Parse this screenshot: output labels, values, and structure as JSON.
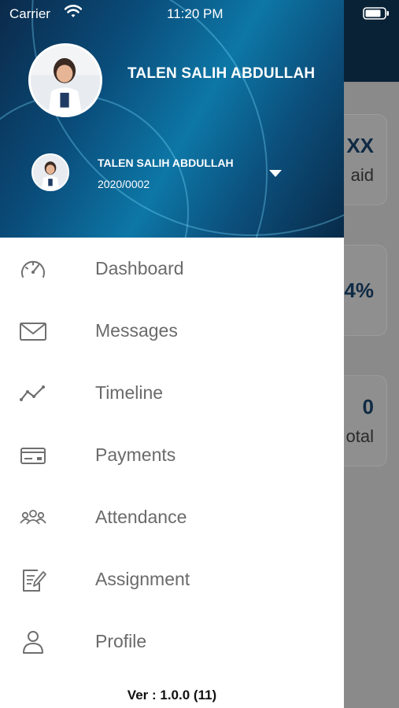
{
  "status_bar": {
    "carrier": "Carrier",
    "time": "11:20 PM"
  },
  "profile": {
    "header_name": "TALEN SALIH ABDULLAH"
  },
  "account": {
    "name": "TALEN SALIH ABDULLAH",
    "id": "2020/0002"
  },
  "menu": [
    {
      "label": "Dashboard",
      "icon": "speedometer-icon"
    },
    {
      "label": "Messages",
      "icon": "envelope-icon"
    },
    {
      "label": "Timeline",
      "icon": "trend-line-icon"
    },
    {
      "label": "Payments",
      "icon": "credit-card-icon"
    },
    {
      "label": "Attendance",
      "icon": "group-icon"
    },
    {
      "label": "Assignment",
      "icon": "edit-document-icon"
    },
    {
      "label": "Profile",
      "icon": "user-icon"
    }
  ],
  "version": "Ver : 1.0.0 (11)",
  "background_cards": [
    {
      "big": "XX",
      "small": "aid"
    },
    {
      "big": "4%",
      "small": ""
    },
    {
      "big": "0",
      "small": "otal"
    }
  ],
  "colors": {
    "header_dark": "#0b2a4a",
    "header_light": "#0d77a6",
    "menu_text": "#6a6a6a",
    "overlay": "#8a8a8a"
  }
}
